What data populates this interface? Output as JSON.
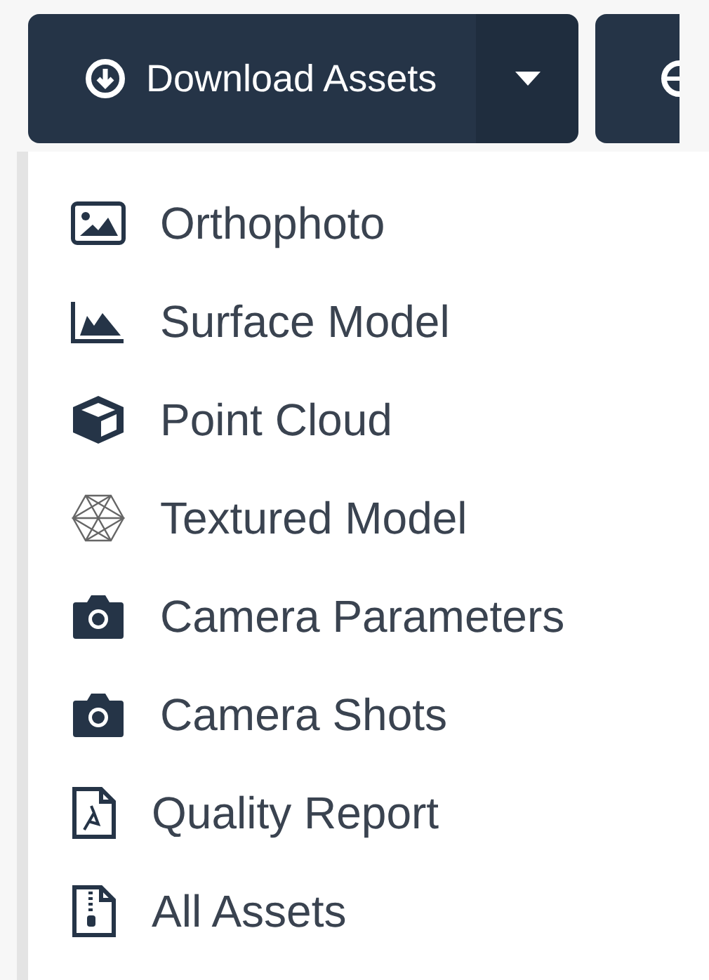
{
  "toolbar": {
    "download_button": {
      "label": "Download Assets"
    }
  },
  "menu": {
    "items": [
      {
        "label": "Orthophoto"
      },
      {
        "label": "Surface Model"
      },
      {
        "label": "Point Cloud"
      },
      {
        "label": "Textured Model"
      },
      {
        "label": "Camera Parameters"
      },
      {
        "label": "Camera Shots"
      },
      {
        "label": "Quality Report"
      },
      {
        "label": "All Assets"
      }
    ]
  }
}
